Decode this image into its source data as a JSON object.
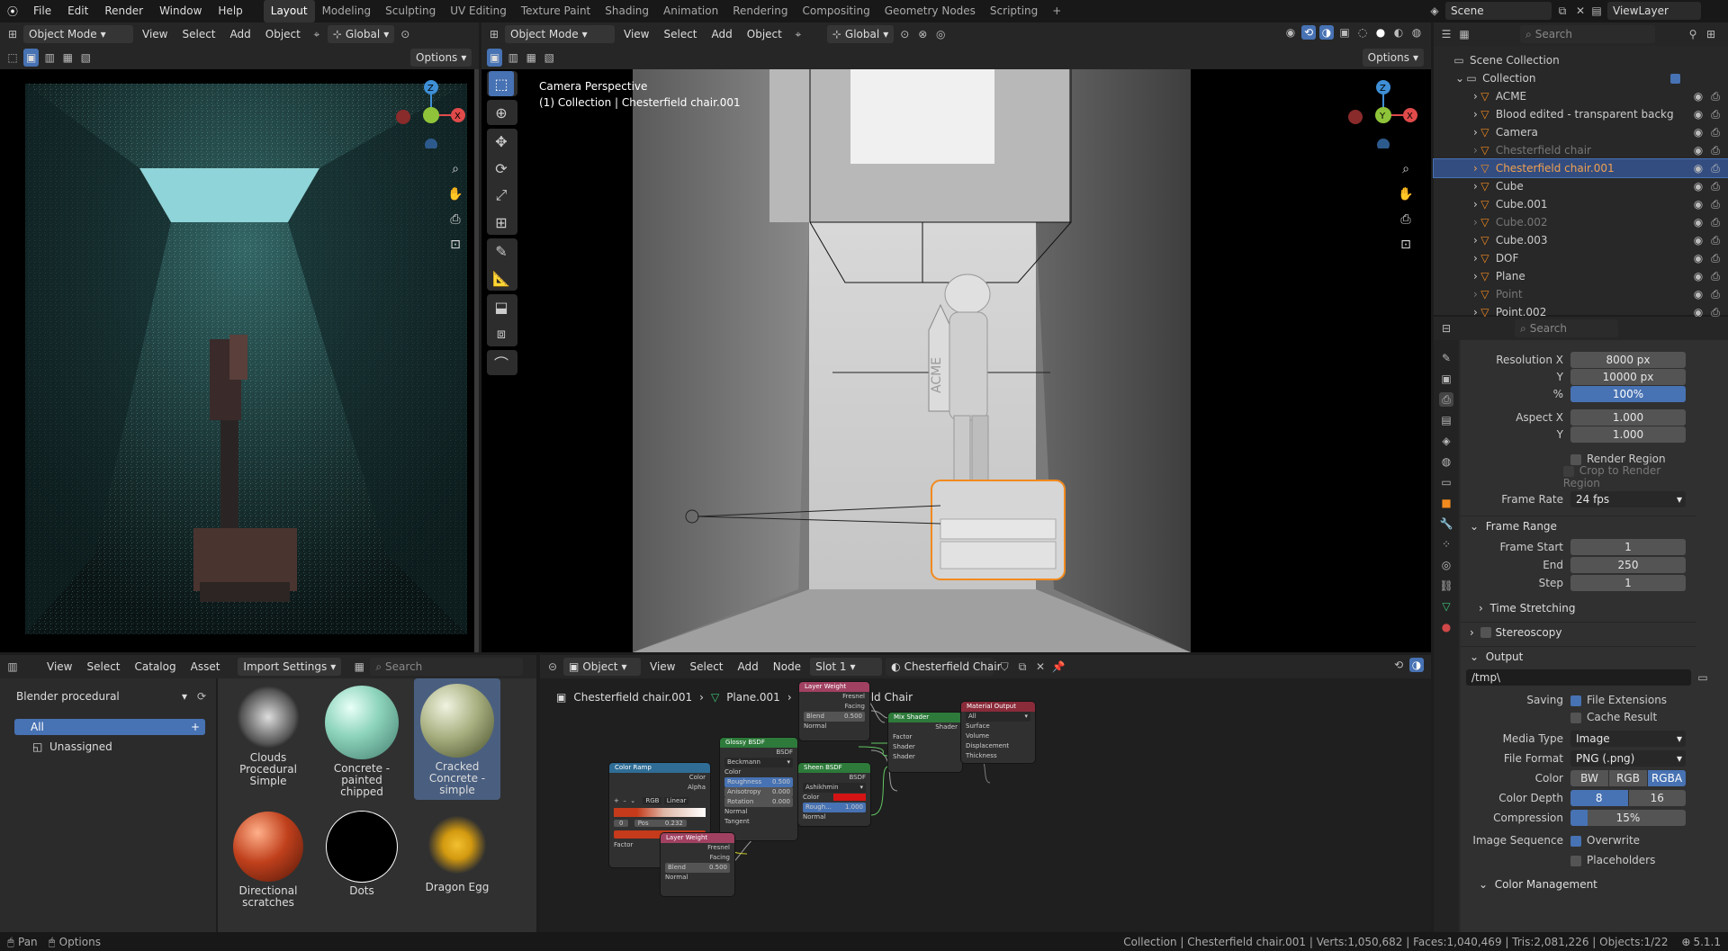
{
  "topbar": {
    "menus": [
      "File",
      "Edit",
      "Render",
      "Window",
      "Help"
    ],
    "workspaces": [
      "Layout",
      "Modeling",
      "Sculpting",
      "UV Editing",
      "Texture Paint",
      "Shading",
      "Animation",
      "Rendering",
      "Compositing",
      "Geometry Nodes",
      "Scripting"
    ],
    "active_workspace": "Layout",
    "add_tab": "+",
    "scene": "Scene",
    "view_layer": "ViewLayer"
  },
  "viewport_left": {
    "mode": "Object Mode",
    "menus": [
      "View",
      "Select",
      "Add",
      "Object"
    ],
    "transform": "Global",
    "options": "Options"
  },
  "viewport_main": {
    "mode": "Object Mode",
    "menus": [
      "View",
      "Select",
      "Add",
      "Object"
    ],
    "transform": "Global",
    "options": "Options",
    "overlay_title": "Camera Perspective",
    "overlay_subtitle": "(1) Collection | Chesterfield chair.001",
    "acme_text": "ACME",
    "axis": {
      "x": "X",
      "y": "Y",
      "z": "Z"
    }
  },
  "outliner": {
    "search_placeholder": "Search",
    "scene_collection": "Scene Collection",
    "collection": "Collection",
    "items": [
      {
        "name": "ACME",
        "dim": false,
        "selected": false
      },
      {
        "name": "Blood edited - transparent backg",
        "dim": false,
        "selected": false
      },
      {
        "name": "Camera",
        "dim": false,
        "selected": false
      },
      {
        "name": "Chesterfield chair",
        "dim": true,
        "selected": false
      },
      {
        "name": "Chesterfield chair.001",
        "dim": false,
        "selected": true
      },
      {
        "name": "Cube",
        "dim": false,
        "selected": false
      },
      {
        "name": "Cube.001",
        "dim": false,
        "selected": false
      },
      {
        "name": "Cube.002",
        "dim": true,
        "selected": false
      },
      {
        "name": "Cube.003",
        "dim": false,
        "selected": false
      },
      {
        "name": "DOF",
        "dim": false,
        "selected": false
      },
      {
        "name": "Plane",
        "dim": false,
        "selected": false
      },
      {
        "name": "Point",
        "dim": true,
        "selected": false
      },
      {
        "name": "Point.002",
        "dim": false,
        "selected": false
      }
    ]
  },
  "properties": {
    "search_placeholder": "Search",
    "resolution_x_label": "Resolution X",
    "resolution_x": "8000 px",
    "y_label": "Y",
    "resolution_y": "10000 px",
    "percent_label": "%",
    "percent": "100%",
    "aspect_x_label": "Aspect X",
    "aspect_x": "1.000",
    "aspect_y": "1.000",
    "render_region": "Render Region",
    "crop_region": "Crop to Render Region",
    "frame_rate_label": "Frame Rate",
    "frame_rate": "24 fps",
    "frame_range": "Frame Range",
    "frame_start_label": "Frame Start",
    "frame_start": "1",
    "end_label": "End",
    "frame_end": "250",
    "step_label": "Step",
    "frame_step": "1",
    "time_stretching": "Time Stretching",
    "stereoscopy": "Stereoscopy",
    "output": "Output",
    "output_path": "/tmp\\",
    "saving_label": "Saving",
    "file_extensions": "File Extensions",
    "cache_result": "Cache Result",
    "media_type_label": "Media Type",
    "media_type": "Image",
    "file_format_label": "File Format",
    "file_format": "PNG (.png)",
    "color_label": "Color",
    "color_bw": "BW",
    "color_rgb": "RGB",
    "color_rgba": "RGBA",
    "color_depth_label": "Color Depth",
    "depth_8": "8",
    "depth_16": "16",
    "compression_label": "Compression",
    "compression": "15%",
    "compression_value": 0.15,
    "image_sequence_label": "Image Sequence",
    "overwrite": "Overwrite",
    "placeholders": "Placeholders",
    "color_management": "Color Management"
  },
  "asset_browser": {
    "menus": [
      "View",
      "Select",
      "Catalog",
      "Asset"
    ],
    "import_settings": "Import Settings",
    "search_placeholder": "Search",
    "library": "Blender procedural",
    "catalog_all": "All",
    "catalog_unassigned": "Unassigned",
    "assets": [
      {
        "line1": "Clouds",
        "line2": "Procedural Simple"
      },
      {
        "line1": "Concrete -",
        "line2": "painted chipped"
      },
      {
        "line1": "Cracked",
        "line2": "Concrete - simple"
      },
      {
        "line1": "Directional",
        "line2": "scratches"
      },
      {
        "line1": "Dots",
        "line2": ""
      },
      {
        "line1": "Dragon Egg",
        "line2": ""
      }
    ]
  },
  "node_editor": {
    "object_mode": "Object",
    "menus": [
      "View",
      "Select",
      "Add",
      "Node"
    ],
    "slot": "Slot 1",
    "material": "Chesterfield Chair",
    "breadcrumb": [
      "Chesterfield chair.001",
      "Plane.001",
      "Chesterfield Chair"
    ],
    "nodes": {
      "layer_weight_top": {
        "title": "Layer Weight",
        "fresnel": "Fresnel",
        "facing": "Facing",
        "blend": "Blend",
        "blend_val": "0.500",
        "normal": "Normal"
      },
      "mix_shader": {
        "title": "Mix Shader",
        "shader_out": "Shader",
        "factor": "Factor",
        "shader1": "Shader",
        "shader2": "Shader"
      },
      "material_output": {
        "title": "Material Output",
        "target": "All",
        "surface": "Surface",
        "volume": "Volume",
        "displacement": "Displacement",
        "thickness": "Thickness"
      },
      "glossy": {
        "title": "Glossy BSDF",
        "out": "BSDF",
        "dist": "Beckmann",
        "color": "Color",
        "roughness": "Roughness",
        "roughness_val": "0.500",
        "anisotropy": "Anisotropy",
        "anisotropy_val": "0.000",
        "rotation": "Rotation",
        "rotation_val": "0.000",
        "normal": "Normal",
        "tangent": "Tangent"
      },
      "color_ramp": {
        "title": "Color Ramp",
        "color": "Color",
        "alpha": "Alpha",
        "mode": "RGB",
        "interp": "Linear",
        "index": "0",
        "pos_label": "Pos",
        "pos": "0.232",
        "factor": "Factor"
      },
      "sheen": {
        "title": "Sheen BSDF",
        "out": "BSDF",
        "dist": "Ashikhmin",
        "color": "Color",
        "rough": "Rough...",
        "rough_val": "1.000",
        "normal": "Normal"
      },
      "layer_weight_bottom": {
        "title": "Layer Weight",
        "fresnel": "Fresnel",
        "facing": "Facing",
        "blend": "Blend",
        "blend_val": "0.500",
        "normal": "Normal"
      }
    }
  },
  "statusbar": {
    "pan": "Pan",
    "options": "Options",
    "stats": "Collection | Chesterfield chair.001 | Verts:1,050,682 | Faces:1,040,469 | Tris:2,081,226 | Objects:1/22",
    "version": "5.1.1"
  },
  "colors": {
    "accent": "#4772b3",
    "selected_orange": "#f28a1e",
    "viewport_bg": "#000000",
    "panel_bg": "#303030"
  }
}
